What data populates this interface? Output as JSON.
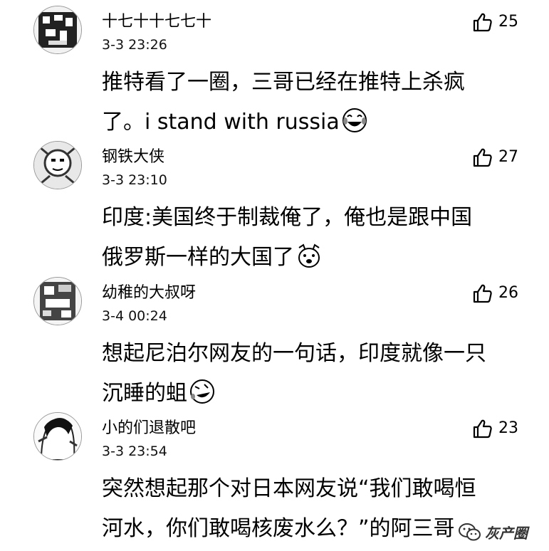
{
  "comments": [
    {
      "username": "十七十十七七十",
      "time": "3-3 23:26",
      "likes": "25",
      "lines": [
        "推特看了一圈，三哥已经在推特上杀疯",
        "了。i stand with russia"
      ],
      "emoji": "laughing-tears-emoji"
    },
    {
      "username": "钢铁大侠",
      "time": "3-3 23:10",
      "likes": "27",
      "lines": [
        "印度:美国终于制裁俺了，俺也是跟中国",
        "俄罗斯一样的大国了"
      ],
      "emoji": "doge-emoji"
    },
    {
      "username": "幼稚的大叔呀",
      "time": "3-4 00:24",
      "likes": "26",
      "lines": [
        "想起尼泊尔网友的一句话，印度就像一只",
        "沉睡的蛆"
      ],
      "emoji": "tilted-laughing-emoji"
    },
    {
      "username": "小的们退散吧",
      "time": "3-3 23:54",
      "likes": "23",
      "lines": [
        "突然想起那个对日本网友说“我们敢喝恒",
        "河水，你们敢喝核废水么？”的阿三哥"
      ],
      "emoji": ""
    }
  ],
  "watermark": {
    "text": "灰产圈",
    "icon": "wechat-icon"
  }
}
